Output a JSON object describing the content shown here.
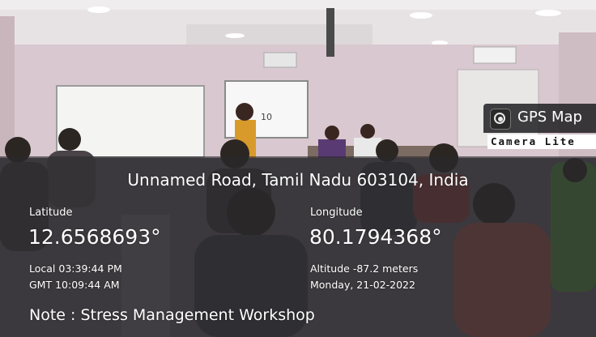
{
  "geotag": {
    "address": "Unnamed Road, Tamil Nadu 603104, India",
    "latitude_label": "Latitude",
    "latitude_value": "12.6568693°",
    "longitude_label": "Longitude",
    "longitude_value": "80.1794368°",
    "local_time": "Local 03:39:44 PM",
    "gmt_time": "GMT 10:09:44 AM",
    "altitude": "Altitude -87.2 meters",
    "date": "Monday, 21-02-2022",
    "note": "Note : Stress Management Workshop"
  },
  "badge": {
    "title": "GPS Map",
    "subtitle": "Camera Lite",
    "icon": "camera-lens-icon"
  },
  "board_text": "10"
}
